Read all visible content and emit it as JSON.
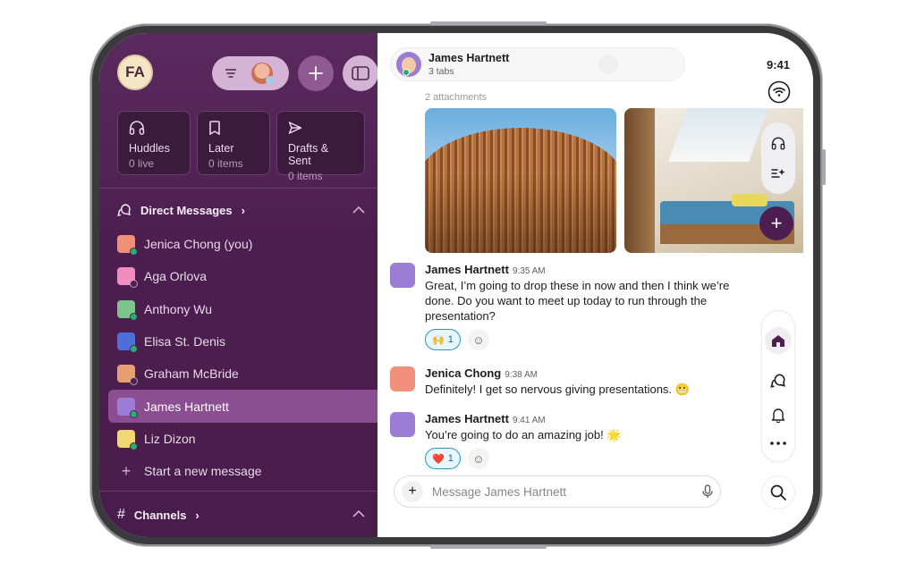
{
  "colors": {
    "sidebar": "#4d1f50",
    "accent": "#8b4e90",
    "online": "#2bac76",
    "reaction_border": "#1d9bd1"
  },
  "user": {
    "initials": "FA"
  },
  "cards": [
    {
      "label": "Huddles",
      "sub": "0 live",
      "icon": "headphones-icon"
    },
    {
      "label": "Later",
      "sub": "0 items",
      "icon": "bookmark-icon"
    },
    {
      "label": "Drafts & Sent",
      "sub": "0 items",
      "icon": "send-icon"
    }
  ],
  "direct_messages": {
    "title": "Direct Messages",
    "chevron": "›",
    "items": [
      {
        "name": "Jenica Chong (you)",
        "color": "#f0907a"
      },
      {
        "name": "Aga Orlova",
        "color": "#f08cc0"
      },
      {
        "name": "Anthony Wu",
        "color": "#7cc58a"
      },
      {
        "name": "Elisa St. Denis",
        "color": "#4f6fd8"
      },
      {
        "name": "Graham McBride",
        "color": "#e8a070"
      },
      {
        "name": "James Hartnett",
        "color": "#9b7dd6"
      },
      {
        "name": "Liz Dizon",
        "color": "#f3d770"
      }
    ],
    "new_message": "Start a new message"
  },
  "channels": {
    "title": "Channels",
    "chevron": "›"
  },
  "conversation": {
    "name": "James Hartnett",
    "tabs": "3 tabs",
    "time": "9:41",
    "attachments": "2 attachments"
  },
  "messages": [
    {
      "author": "James Hartnett",
      "time": "9:35 AM",
      "text": "Great, I’m going to drop these in now and then I think we’re done. Do you want to meet up today to run through the presentation?",
      "reaction": "🙌",
      "count": "1"
    },
    {
      "author": "Jenica Chong",
      "time": "9:38 AM",
      "text": "Definitely! I get so nervous giving presentations. 😬"
    },
    {
      "author": "James Hartnett",
      "time": "9:41 AM",
      "text": "You’re going to do an amazing job! 🌟",
      "reaction": "❤️",
      "count": "1"
    }
  ],
  "composer": {
    "placeholder": "Message James Hartnett"
  }
}
